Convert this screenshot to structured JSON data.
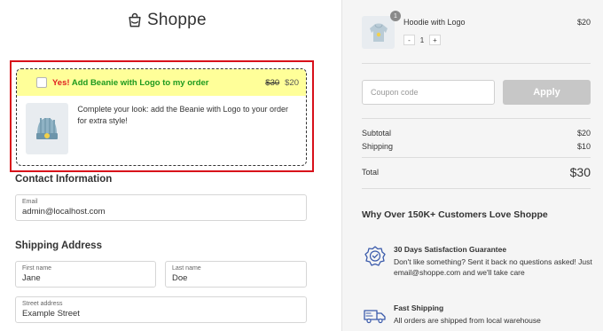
{
  "brand": {
    "name": "Shoppe"
  },
  "bump": {
    "yes": "Yes!",
    "title": "Add Beanie with Logo to my order",
    "old_price": "$30",
    "new_price": "$20",
    "description": "Complete your look: add the Beanie with Logo to your order for extra style!",
    "checked": false
  },
  "contact": {
    "title": "Contact Information",
    "email_label": "Email",
    "email_value": "admin@localhost.com"
  },
  "shipping": {
    "title": "Shipping Address",
    "first_name_label": "First name",
    "first_name_value": "Jane",
    "last_name_label": "Last name",
    "last_name_value": "Doe",
    "street_label": "Street address",
    "street_value": "Example Street"
  },
  "cart": {
    "item_name": "Hoodie with Logo",
    "item_price": "$20",
    "quantity_badge": "1",
    "minus": "-",
    "quantity": "1",
    "plus": "+"
  },
  "coupon": {
    "placeholder": "Coupon code",
    "apply_label": "Apply"
  },
  "summary": {
    "subtotal_label": "Subtotal",
    "subtotal_value": "$20",
    "shipping_label": "Shipping",
    "shipping_value": "$10",
    "total_label": "Total",
    "total_value": "$30"
  },
  "why": {
    "title": "Why Over 150K+ Customers Love Shoppe",
    "features": [
      {
        "icon": "badge-check-icon",
        "title": "30 Days Satisfaction Guarantee",
        "text": "Don't like something? Sent it back no questions asked! Just email@shoppe.com and we'll take care"
      },
      {
        "icon": "truck-icon",
        "title": "Fast Shipping",
        "text": "All orders are shipped from local warehouse"
      }
    ]
  },
  "colors": {
    "bump_highlight": "#ffff99",
    "bump_outline": "#d8101a",
    "yes_red": "#e02020",
    "add_green": "#1e9a1e",
    "apply_button": "#c7c7c7",
    "icon_blue": "#3b5bab"
  }
}
